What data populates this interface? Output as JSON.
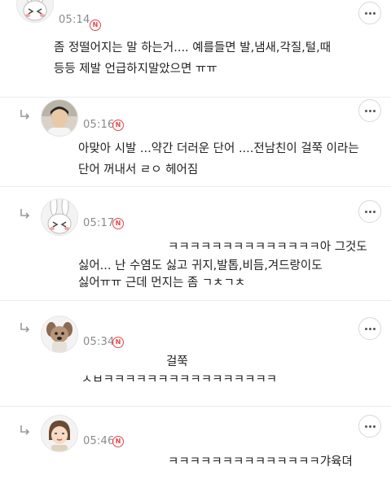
{
  "comments": [
    {
      "time": "05:14",
      "badge": "N",
      "avatar_icon": "bunny-avatar-icon",
      "lines": [
        "좀 정떨어지는 말 하는거.... 예를들면 발,냄새,각질,털,때",
        "등등 제발 언급하지말았으면 ㅠㅠ"
      ]
    },
    {
      "time": "05:16",
      "badge": "N",
      "avatar_icon": "person-photo-avatar-icon",
      "lines": [
        "아맞아 시발 ...약간 더러운 단어 ....전남친이 걸쭉 이라는",
        "단어 꺼내서 ㄹㅇ 헤어짐"
      ]
    },
    {
      "time": "05:17",
      "badge": "N",
      "avatar_icon": "bunny-avatar-icon",
      "lines": [
        "ㅋㅋㅋㅋㅋㅋㅋㅋㅋㅋㅋㅋㅋㅋ아 그것도",
        "싫어... 난 수염도 싫고 귀지,발톱,비듬,겨드랑이도",
        "싫어ㅠㅠ 근데 먼지는 좀 ㄱㅊㄱㅊ"
      ]
    },
    {
      "time": "05:34",
      "badge": "N",
      "avatar_icon": "dog-avatar-icon",
      "lines": [
        "걸쭉",
        "ㅅㅂㅋㅋㅋㅋㅋㅋㅋㅋㅋㅋㅋㅋㅋㅋㅋㅋ"
      ]
    },
    {
      "time": "05:46",
      "badge": "N",
      "avatar_icon": "girl-avatar-icon",
      "lines": [
        "ㅋㅋㅋㅋㅋㅋㅋㅋㅋㅋㅋㅋㅋㅋ갸육뎌"
      ]
    }
  ]
}
